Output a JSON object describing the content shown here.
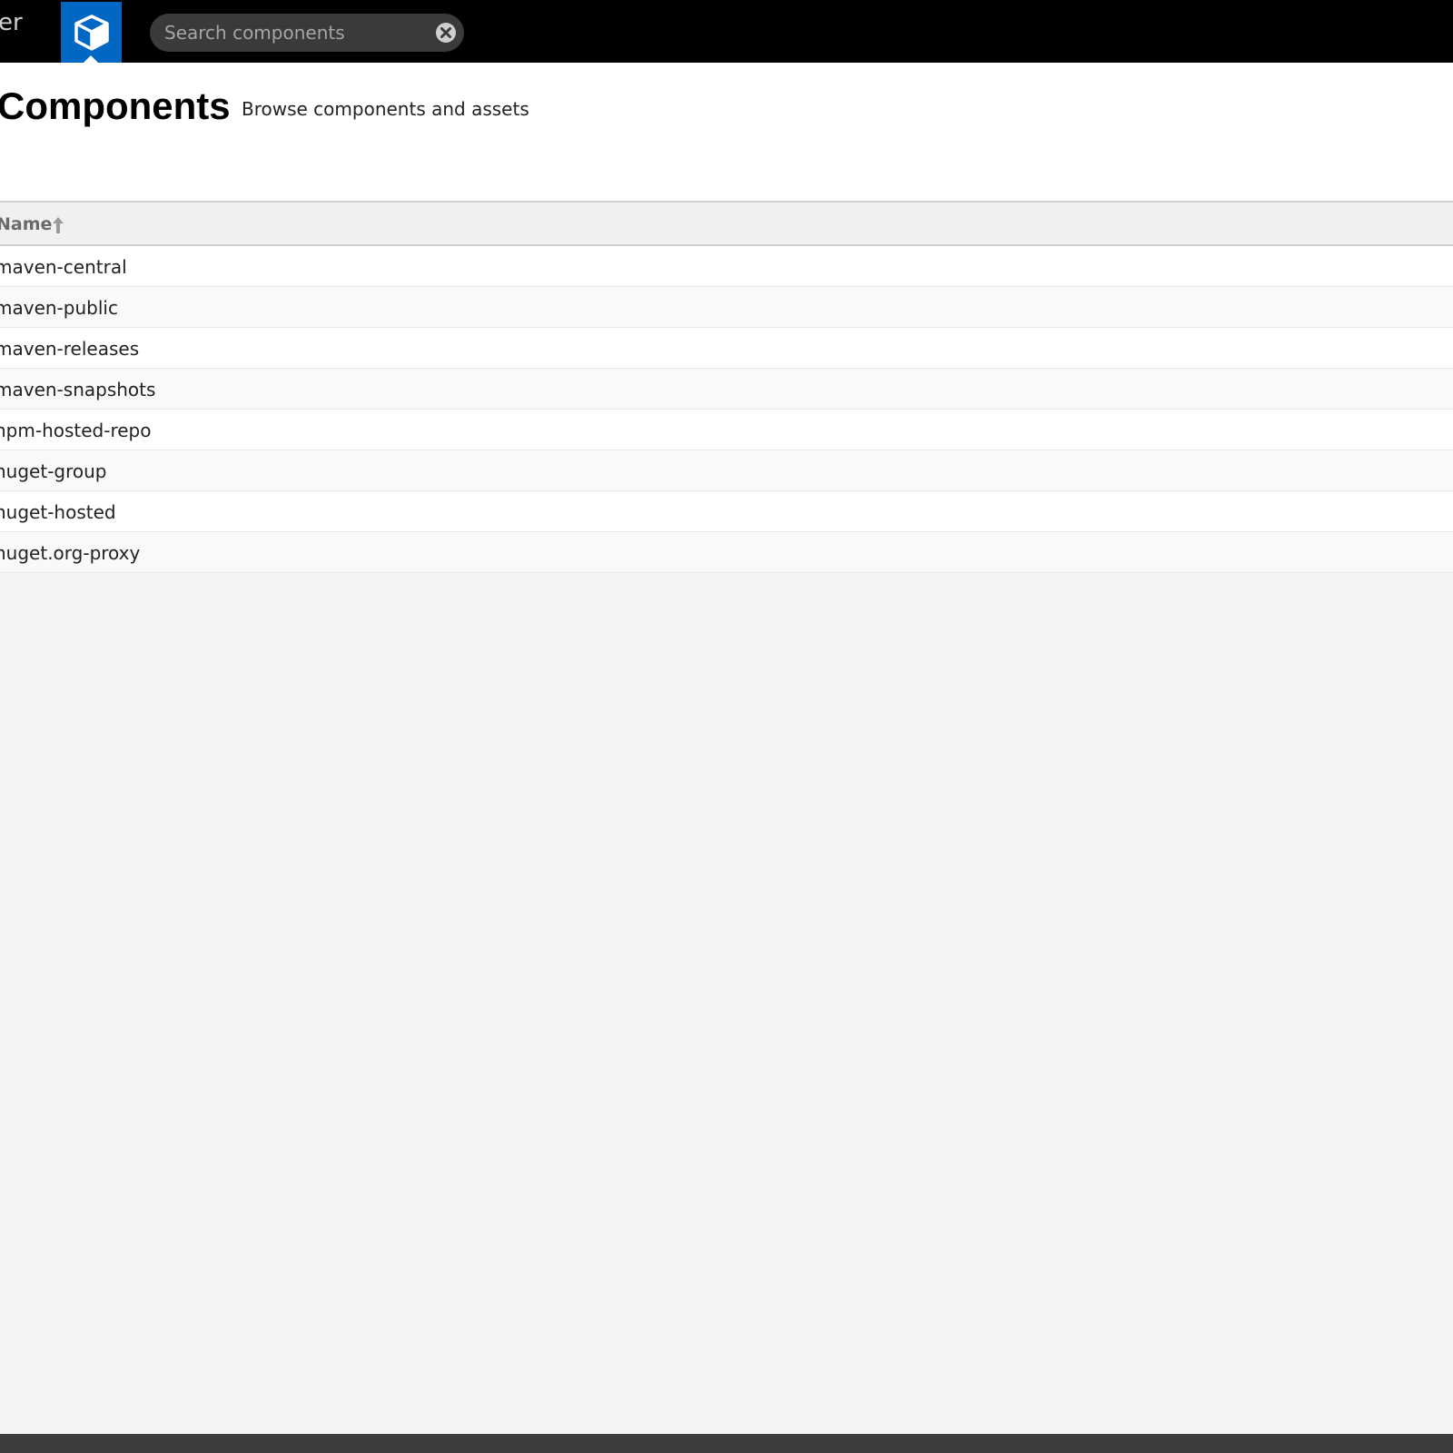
{
  "topbar": {
    "brand_fragment": "er",
    "browse_mode_icon": "cube-icon",
    "search": {
      "placeholder": "Search components",
      "value": "",
      "clear_icon": "clear-x-icon"
    }
  },
  "header": {
    "title": "Components",
    "subtitle": "Browse components and assets"
  },
  "grid": {
    "columns": [
      {
        "label": "Name",
        "sort": "ascending",
        "sort_icon": "arrow-up-icon"
      }
    ],
    "rows": [
      {
        "name": "maven-central"
      },
      {
        "name": "maven-public"
      },
      {
        "name": "maven-releases"
      },
      {
        "name": "maven-snapshots"
      },
      {
        "name": "npm-hosted-repo"
      },
      {
        "name": "nuget-group"
      },
      {
        "name": "nuget-hosted"
      },
      {
        "name": "nuget.org-proxy"
      }
    ]
  },
  "colors": {
    "topbar_bg": "#000000",
    "accent": "#0067c5",
    "page_bg": "#f4f4f4",
    "header_bg": "#ffffff",
    "footer_bg": "#3c3c3c"
  }
}
